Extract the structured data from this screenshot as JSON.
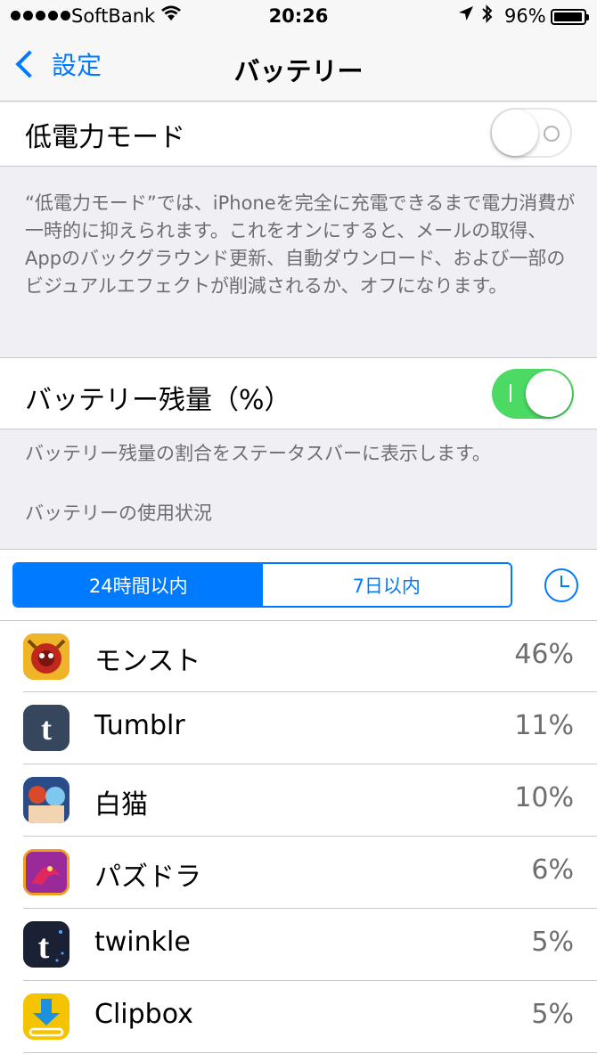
{
  "status": {
    "carrier": "SoftBank",
    "time": "20:26",
    "battery_pct": "96%",
    "battery_level": 0.96
  },
  "nav": {
    "back_label": "設定",
    "title": "バッテリー"
  },
  "low_power": {
    "label": "低電力モード",
    "enabled": false,
    "footer": "“低電力モード”では、iPhoneを完全に充電できるまで電力消費が一時的に抑えられます。これをオンにすると、メールの取得、Appのバックグラウンド更新、自動ダウンロード、および一部のビジュアルエフェクトが削減されるか、オフになります。"
  },
  "battery_percentage": {
    "label": "バッテリー残量（%）",
    "enabled": true,
    "footer": "バッテリー残量の割合をステータスバーに表示します。"
  },
  "usage": {
    "header": "バッテリーの使用状況",
    "segments": [
      "24時間以内",
      "7日以内"
    ],
    "selected_segment": 0,
    "apps": [
      {
        "name": "モンスト",
        "percent": "46%",
        "icon": "monster-strike-icon",
        "color": "#e8a020"
      },
      {
        "name": "Tumblr",
        "percent": "11%",
        "icon": "tumblr-icon",
        "color": "#36465d"
      },
      {
        "name": "白猫",
        "percent": "10%",
        "icon": "shironeko-icon",
        "color": "#3a6fb5"
      },
      {
        "name": "パズドラ",
        "percent": "6%",
        "icon": "puzzle-dragons-icon",
        "color": "#8a2a8a"
      },
      {
        "name": "twinkle",
        "percent": "5%",
        "icon": "twinkle-icon",
        "color": "#1b2135"
      },
      {
        "name": "Clipbox",
        "percent": "5%",
        "icon": "clipbox-icon",
        "color": "#f5c400"
      }
    ]
  },
  "colors": {
    "accent": "#007aff",
    "switch_on": "#4cd964",
    "background": "#efeff4"
  }
}
